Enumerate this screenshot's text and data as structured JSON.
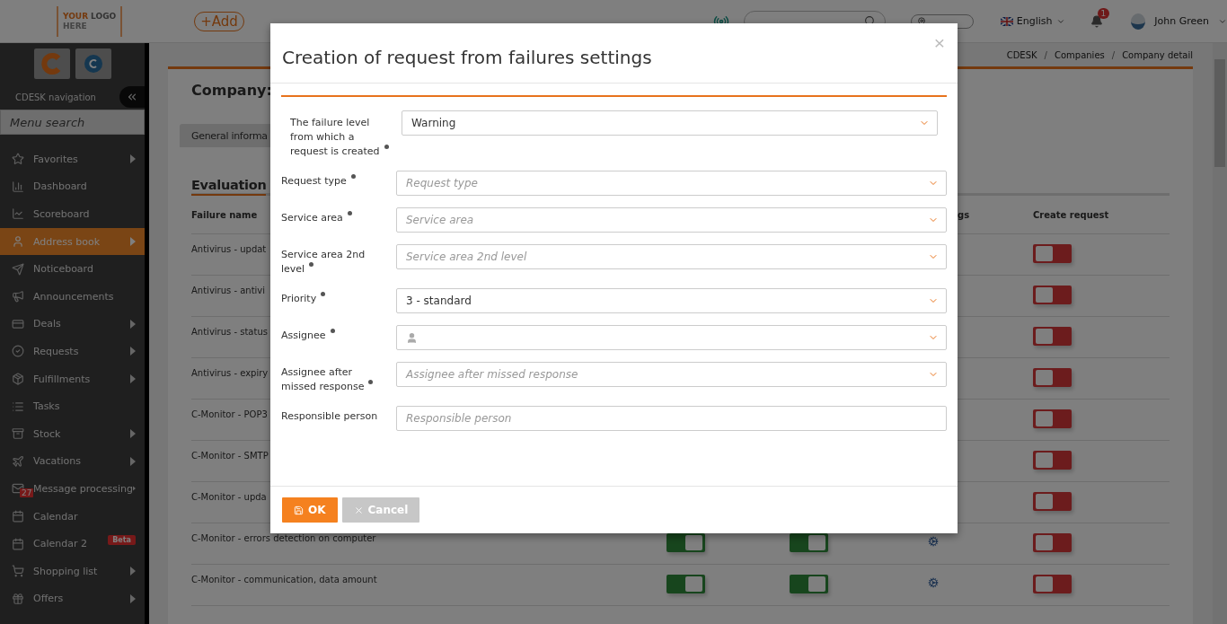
{
  "topbar": {
    "logo": {
      "accent": "YOUR",
      "text": "LOGO",
      "sub": "HERE"
    },
    "add_button": "+Add",
    "language": "English",
    "notifications": "1",
    "user": "John Green"
  },
  "sidebar": {
    "title": "CDESK navigation",
    "search": {
      "placeholder": "Menu search"
    },
    "items": [
      {
        "label": "Favorites",
        "selected": false,
        "expandable": true
      },
      {
        "label": "Dashboard",
        "selected": false,
        "expandable": false
      },
      {
        "label": "Scoreboard",
        "selected": false,
        "expandable": false
      },
      {
        "label": "Address book",
        "selected": true,
        "expandable": true
      },
      {
        "label": "Noticeboard",
        "selected": false,
        "expandable": false
      },
      {
        "label": "Announcements",
        "selected": false,
        "expandable": false
      },
      {
        "label": "Deals",
        "selected": false,
        "expandable": true
      },
      {
        "label": "Requests",
        "selected": false,
        "expandable": true
      },
      {
        "label": "Fulfillments",
        "selected": false,
        "expandable": true
      },
      {
        "label": "Tasks",
        "selected": false,
        "expandable": false
      },
      {
        "label": "Stock",
        "selected": false,
        "expandable": true
      },
      {
        "label": "Vacations",
        "selected": false,
        "expandable": true
      },
      {
        "label": "Message processing",
        "selected": false,
        "expandable": true,
        "badge": "27"
      },
      {
        "label": "Calendar",
        "selected": false,
        "expandable": false
      },
      {
        "label": "Calendar 2",
        "selected": false,
        "expandable": false,
        "tag": "Beta"
      },
      {
        "label": "Shopping list",
        "selected": false,
        "expandable": true
      },
      {
        "label": "Offers",
        "selected": false,
        "expandable": true
      }
    ]
  },
  "breadcrumbs": [
    {
      "kind": "link",
      "label": "CDESK"
    },
    {
      "kind": "separator",
      "label": "/"
    },
    {
      "kind": "link",
      "label": "Companies"
    },
    {
      "kind": "separator",
      "label": "/"
    },
    {
      "kind": "link",
      "label": "Company detail"
    }
  ],
  "page": {
    "title": "Company:",
    "tabs": [
      {
        "label": "General informa",
        "selected": true
      }
    ],
    "section": "Evaluation",
    "table": {
      "columns": [
        "Failure name",
        "gs",
        "Create request"
      ],
      "rows": [
        {
          "name": "Antivirus - updat",
          "create_request": false
        },
        {
          "name": "Antivirus - antivi",
          "create_request": false
        },
        {
          "name": "Antivirus - status",
          "create_request": false
        },
        {
          "name": "Antivirus - expiry",
          "create_request": false
        },
        {
          "name": "C-Monitor - POP3",
          "create_request": false
        },
        {
          "name": "C-Monitor - SMTP",
          "create_request": false
        },
        {
          "name": "C-Monitor - upda",
          "create_request": false
        },
        {
          "name": "C-Monitor - errors detection on computer",
          "toggle_a": true,
          "toggle_b": true,
          "create_request": false
        },
        {
          "name": "C-Monitor - communication, data amount",
          "toggle_a": true,
          "toggle_b": true,
          "create_request": false
        }
      ]
    }
  },
  "dialog": {
    "title": "Creation of request from failures settings",
    "close": "×",
    "fields": [
      {
        "label": "The failure level from which a request is created",
        "required": true,
        "kind": "select",
        "value": "Warning"
      },
      {
        "label": "Request type",
        "required": true,
        "kind": "select",
        "placeholder": "Request type"
      },
      {
        "label": "Service area",
        "required": true,
        "kind": "select",
        "placeholder": "Service area"
      },
      {
        "label": "Service area 2nd level",
        "required": true,
        "kind": "select",
        "placeholder": "Service area 2nd level"
      },
      {
        "label": "Priority",
        "required": true,
        "kind": "select",
        "value": "3 - standard"
      },
      {
        "label": "Assignee",
        "required": true,
        "kind": "user_select"
      },
      {
        "label": "Assignee after missed response",
        "required": true,
        "kind": "select",
        "placeholder": "Assignee after missed response"
      },
      {
        "label": "Responsible person",
        "required": false,
        "kind": "input",
        "placeholder": "Responsible person"
      }
    ],
    "buttons": [
      {
        "label": "OK",
        "kind": "primary"
      },
      {
        "label": "Cancel",
        "kind": "secondary"
      }
    ]
  }
}
